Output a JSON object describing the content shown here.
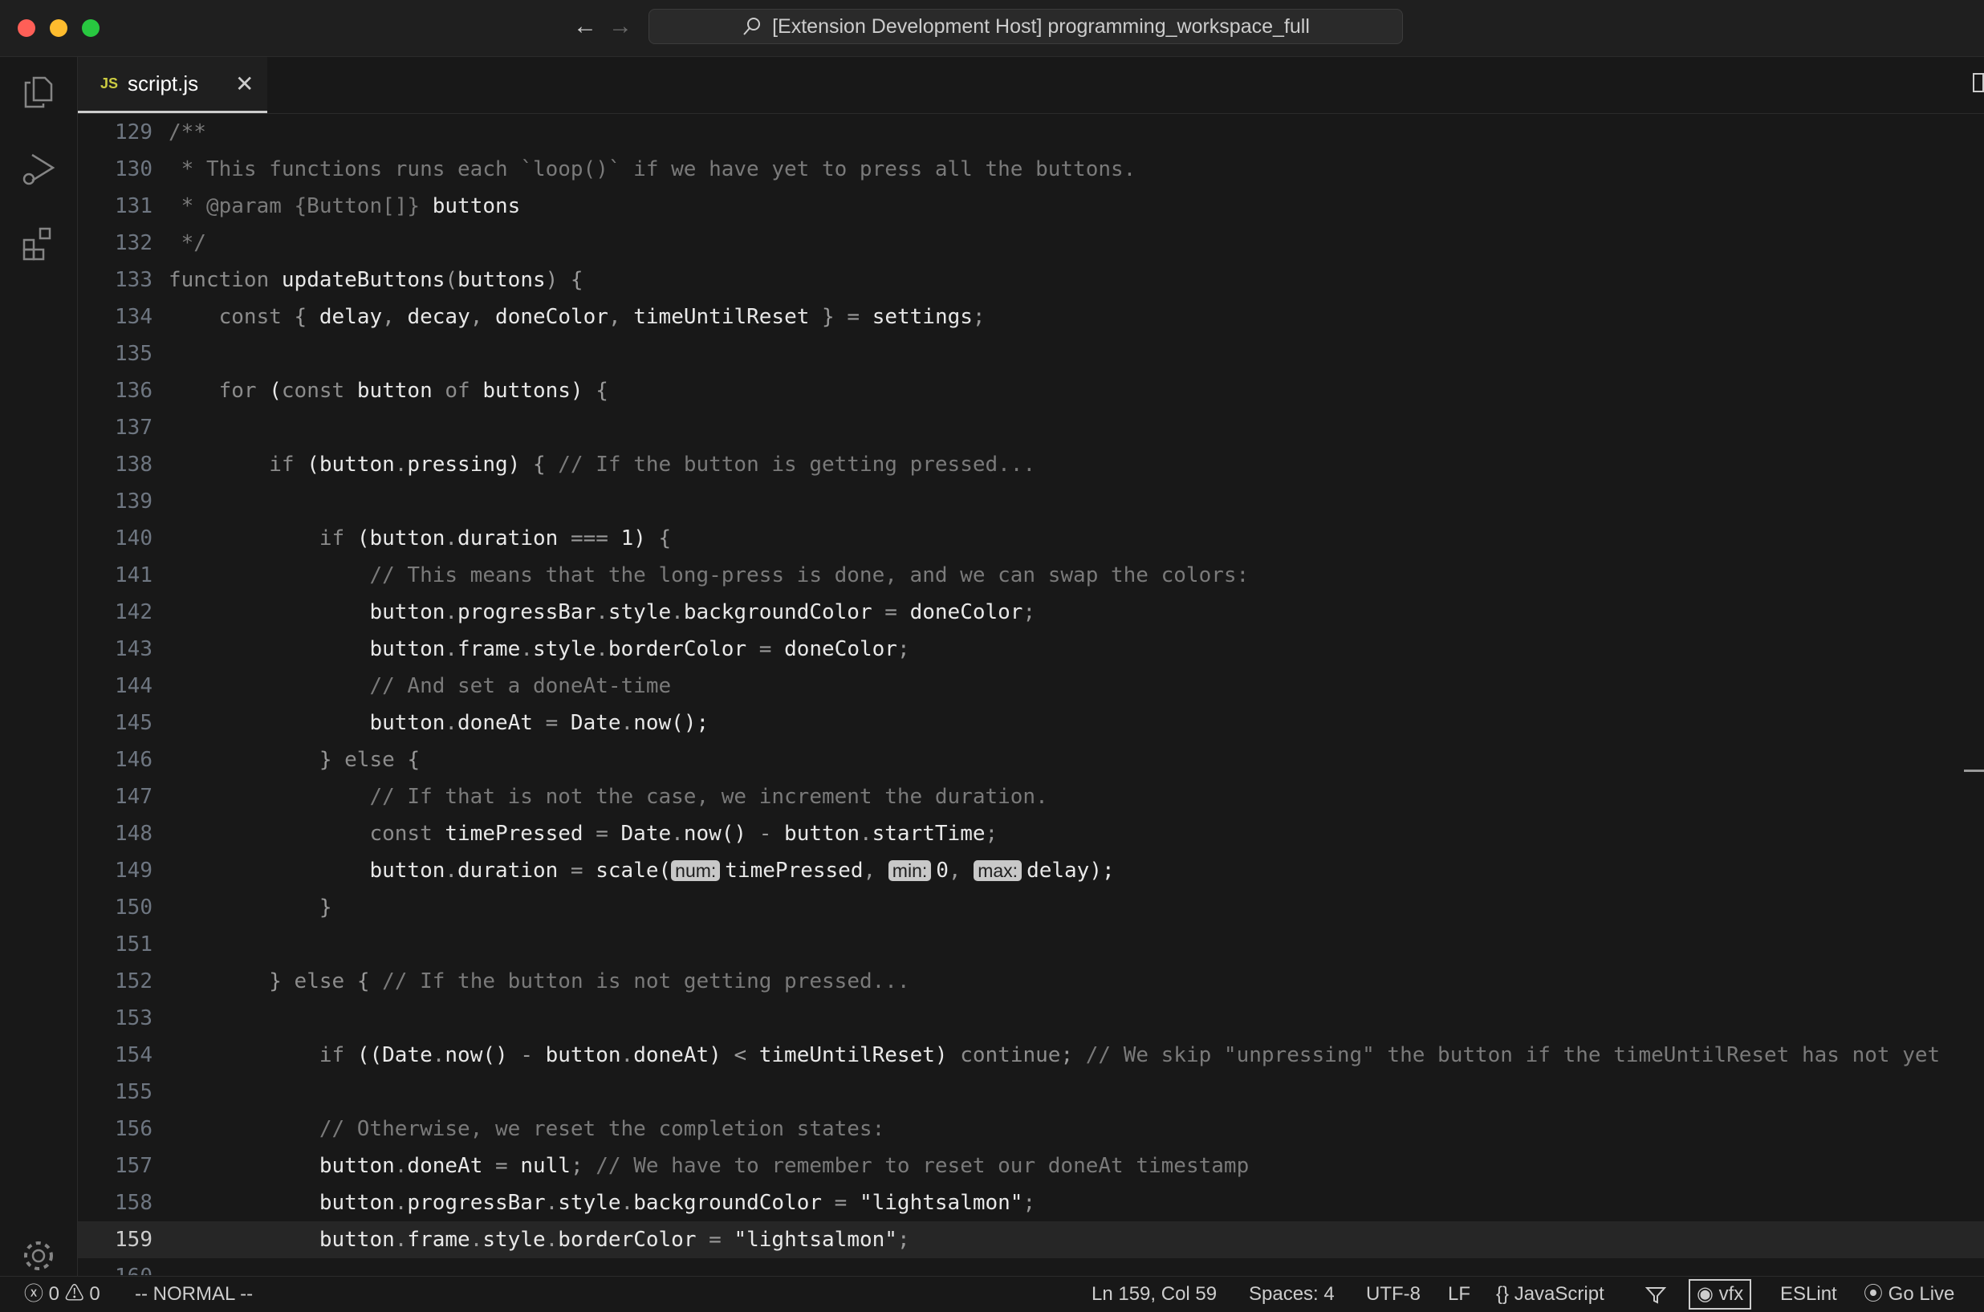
{
  "window": {
    "title": "[Extension Development Host] programming_workspace_full"
  },
  "tab": {
    "icon_label": "JS",
    "filename": "script.js"
  },
  "editor": {
    "lines": [
      {
        "n": "129",
        "tokens": [
          [
            "c-com",
            "/**"
          ]
        ]
      },
      {
        "n": "130",
        "tokens": [
          [
            "c-com",
            " * This functions runs each `loop()` if we have yet to press all the buttons."
          ]
        ]
      },
      {
        "n": "131",
        "tokens": [
          [
            "c-com",
            " * @param {Button[]} "
          ],
          [
            "c-id",
            "buttons"
          ]
        ]
      },
      {
        "n": "132",
        "tokens": [
          [
            "c-com",
            " */"
          ]
        ]
      },
      {
        "n": "133",
        "tokens": [
          [
            "c-kw",
            "function "
          ],
          [
            "c-id",
            "updateButtons"
          ],
          [
            "c-p",
            "("
          ],
          [
            "c-id",
            "buttons"
          ],
          [
            "c-p",
            ") {"
          ]
        ]
      },
      {
        "n": "134",
        "tokens": [
          [
            "c-kw",
            "    const "
          ],
          [
            "c-p",
            "{ "
          ],
          [
            "c-id",
            "delay"
          ],
          [
            "c-p",
            ", "
          ],
          [
            "c-id",
            "decay"
          ],
          [
            "c-p",
            ", "
          ],
          [
            "c-id",
            "doneColor"
          ],
          [
            "c-p",
            ", "
          ],
          [
            "c-id",
            "timeUntilReset"
          ],
          [
            "c-p",
            " } = "
          ],
          [
            "c-id",
            "settings"
          ],
          [
            "c-p",
            ";"
          ]
        ]
      },
      {
        "n": "135",
        "tokens": []
      },
      {
        "n": "136",
        "tokens": [
          [
            "c-kw",
            "    for "
          ],
          [
            "c-id",
            "("
          ],
          [
            "c-kw",
            "const "
          ],
          [
            "c-id",
            "button "
          ],
          [
            "c-kw",
            "of "
          ],
          [
            "c-id",
            "buttons) "
          ],
          [
            "c-p",
            "{"
          ]
        ]
      },
      {
        "n": "137",
        "tokens": []
      },
      {
        "n": "138",
        "tokens": [
          [
            "c-kw",
            "        if "
          ],
          [
            "c-id",
            "(button"
          ],
          [
            "c-p",
            "."
          ],
          [
            "c-id",
            "pressing) "
          ],
          [
            "c-p",
            "{ "
          ],
          [
            "c-com",
            "// If the button is getting pressed..."
          ]
        ]
      },
      {
        "n": "139",
        "tokens": []
      },
      {
        "n": "140",
        "tokens": [
          [
            "c-kw",
            "            if "
          ],
          [
            "c-id",
            "(button"
          ],
          [
            "c-p",
            "."
          ],
          [
            "c-id",
            "duration "
          ],
          [
            "c-p",
            "=== "
          ],
          [
            "c-id",
            "1) "
          ],
          [
            "c-p",
            "{"
          ]
        ]
      },
      {
        "n": "141",
        "tokens": [
          [
            "c-com",
            "                // This means that the long-press is done, and we can swap the colors:"
          ]
        ]
      },
      {
        "n": "142",
        "tokens": [
          [
            "c-id",
            "                button"
          ],
          [
            "c-p",
            "."
          ],
          [
            "c-id",
            "progressBar"
          ],
          [
            "c-p",
            "."
          ],
          [
            "c-id",
            "style"
          ],
          [
            "c-p",
            "."
          ],
          [
            "c-id",
            "backgroundColor "
          ],
          [
            "c-p",
            "= "
          ],
          [
            "c-id",
            "doneColor"
          ],
          [
            "c-p",
            ";"
          ]
        ]
      },
      {
        "n": "143",
        "tokens": [
          [
            "c-id",
            "                button"
          ],
          [
            "c-p",
            "."
          ],
          [
            "c-id",
            "frame"
          ],
          [
            "c-p",
            "."
          ],
          [
            "c-id",
            "style"
          ],
          [
            "c-p",
            "."
          ],
          [
            "c-id",
            "borderColor "
          ],
          [
            "c-p",
            "= "
          ],
          [
            "c-id",
            "doneColor"
          ],
          [
            "c-p",
            ";"
          ]
        ]
      },
      {
        "n": "144",
        "tokens": [
          [
            "c-com",
            "                // And set a doneAt-time"
          ]
        ]
      },
      {
        "n": "145",
        "tokens": [
          [
            "c-id",
            "                button"
          ],
          [
            "c-p",
            "."
          ],
          [
            "c-id",
            "doneAt "
          ],
          [
            "c-p",
            "= "
          ],
          [
            "c-id",
            "Date"
          ],
          [
            "c-p",
            "."
          ],
          [
            "c-id",
            "now();"
          ]
        ]
      },
      {
        "n": "146",
        "tokens": [
          [
            "c-p",
            "            } "
          ],
          [
            "c-kw",
            "else "
          ],
          [
            "c-p",
            "{"
          ]
        ]
      },
      {
        "n": "147",
        "tokens": [
          [
            "c-com",
            "                // If that is not the case, we increment the duration."
          ]
        ]
      },
      {
        "n": "148",
        "tokens": [
          [
            "c-kw",
            "                const "
          ],
          [
            "c-id",
            "timePressed "
          ],
          [
            "c-p",
            "= "
          ],
          [
            "c-id",
            "Date"
          ],
          [
            "c-p",
            "."
          ],
          [
            "c-id",
            "now() "
          ],
          [
            "c-p",
            "- "
          ],
          [
            "c-id",
            "button"
          ],
          [
            "c-p",
            "."
          ],
          [
            "c-id",
            "startTime"
          ],
          [
            "c-p",
            ";"
          ]
        ]
      },
      {
        "n": "149",
        "tokens": [
          [
            "c-id",
            "                button"
          ],
          [
            "c-p",
            "."
          ],
          [
            "c-id",
            "duration "
          ],
          [
            "c-p",
            "= "
          ],
          [
            "c-id",
            "scale("
          ],
          [
            "hint",
            "num:"
          ],
          [
            "c-id",
            "timePressed"
          ],
          [
            "c-p",
            ", "
          ],
          [
            "hint",
            "min:"
          ],
          [
            "c-id",
            "0"
          ],
          [
            "c-p",
            ", "
          ],
          [
            "hint",
            "max:"
          ],
          [
            "c-id",
            "delay);"
          ]
        ]
      },
      {
        "n": "150",
        "tokens": [
          [
            "c-p",
            "            }"
          ]
        ]
      },
      {
        "n": "151",
        "tokens": []
      },
      {
        "n": "152",
        "tokens": [
          [
            "c-p",
            "        } "
          ],
          [
            "c-kw",
            "else "
          ],
          [
            "c-p",
            "{ "
          ],
          [
            "c-com",
            "// If the button is not getting pressed..."
          ]
        ]
      },
      {
        "n": "153",
        "tokens": []
      },
      {
        "n": "154",
        "tokens": [
          [
            "c-kw",
            "            if "
          ],
          [
            "c-id",
            "((Date"
          ],
          [
            "c-p",
            "."
          ],
          [
            "c-id",
            "now() "
          ],
          [
            "c-p",
            "- "
          ],
          [
            "c-id",
            "button"
          ],
          [
            "c-p",
            "."
          ],
          [
            "c-id",
            "doneAt) "
          ],
          [
            "c-p",
            "< "
          ],
          [
            "c-id",
            "timeUntilReset) "
          ],
          [
            "c-kw",
            "continue"
          ],
          [
            "c-p",
            "; "
          ],
          [
            "c-com",
            "// We skip \"unpressing\" the button if the timeUntilReset has not yet"
          ]
        ]
      },
      {
        "n": "155",
        "tokens": []
      },
      {
        "n": "156",
        "tokens": [
          [
            "c-com",
            "            // Otherwise, we reset the completion states:"
          ]
        ]
      },
      {
        "n": "157",
        "tokens": [
          [
            "c-id",
            "            button"
          ],
          [
            "c-p",
            "."
          ],
          [
            "c-id",
            "doneAt "
          ],
          [
            "c-p",
            "= "
          ],
          [
            "c-id",
            "null"
          ],
          [
            "c-p",
            "; "
          ],
          [
            "c-com",
            "// We have to remember to reset our doneAt timestamp"
          ]
        ]
      },
      {
        "n": "158",
        "tokens": [
          [
            "c-id",
            "            button"
          ],
          [
            "c-p",
            "."
          ],
          [
            "c-id",
            "progressBar"
          ],
          [
            "c-p",
            "."
          ],
          [
            "c-id",
            "style"
          ],
          [
            "c-p",
            "."
          ],
          [
            "c-id",
            "backgroundColor "
          ],
          [
            "c-p",
            "= "
          ],
          [
            "c-id",
            "\"lightsalmon\""
          ],
          [
            "c-p",
            ";"
          ]
        ]
      },
      {
        "n": "159",
        "tokens": [
          [
            "c-id",
            "            button"
          ],
          [
            "c-p",
            "."
          ],
          [
            "c-id",
            "frame"
          ],
          [
            "c-p",
            "."
          ],
          [
            "c-id",
            "style"
          ],
          [
            "c-p",
            "."
          ],
          [
            "c-id",
            "borderColor "
          ],
          [
            "c-p",
            "= "
          ],
          [
            "c-id",
            "\"lightsalmon\""
          ],
          [
            "c-p",
            ";"
          ]
        ],
        "current": true
      },
      {
        "n": "160",
        "tokens": []
      }
    ]
  },
  "statusbar": {
    "errors": "0",
    "warnings": "0",
    "vim_mode": "-- NORMAL --",
    "cursor": "Ln 159, Col 59",
    "spaces": "Spaces: 4",
    "encoding": "UTF-8",
    "eol": "LF",
    "language": "JavaScript",
    "vimfx": "vfx",
    "eslint": "ESLint",
    "golive": "Go Live"
  },
  "colors": {
    "accent_close": "#ff5f57",
    "accent_min": "#febc2e",
    "accent_max": "#28c840",
    "js_badge": "#cbcb41"
  }
}
